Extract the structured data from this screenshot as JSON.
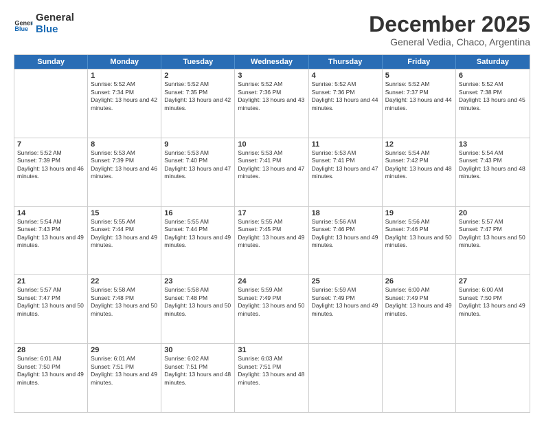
{
  "logo": {
    "general": "General",
    "blue": "Blue"
  },
  "header": {
    "month": "December 2025",
    "location": "General Vedia, Chaco, Argentina"
  },
  "weekdays": [
    "Sunday",
    "Monday",
    "Tuesday",
    "Wednesday",
    "Thursday",
    "Friday",
    "Saturday"
  ],
  "weeks": [
    [
      {
        "day": "",
        "sunrise": "",
        "sunset": "",
        "daylight": ""
      },
      {
        "day": "1",
        "sunrise": "Sunrise: 5:52 AM",
        "sunset": "Sunset: 7:34 PM",
        "daylight": "Daylight: 13 hours and 42 minutes."
      },
      {
        "day": "2",
        "sunrise": "Sunrise: 5:52 AM",
        "sunset": "Sunset: 7:35 PM",
        "daylight": "Daylight: 13 hours and 42 minutes."
      },
      {
        "day": "3",
        "sunrise": "Sunrise: 5:52 AM",
        "sunset": "Sunset: 7:36 PM",
        "daylight": "Daylight: 13 hours and 43 minutes."
      },
      {
        "day": "4",
        "sunrise": "Sunrise: 5:52 AM",
        "sunset": "Sunset: 7:36 PM",
        "daylight": "Daylight: 13 hours and 44 minutes."
      },
      {
        "day": "5",
        "sunrise": "Sunrise: 5:52 AM",
        "sunset": "Sunset: 7:37 PM",
        "daylight": "Daylight: 13 hours and 44 minutes."
      },
      {
        "day": "6",
        "sunrise": "Sunrise: 5:52 AM",
        "sunset": "Sunset: 7:38 PM",
        "daylight": "Daylight: 13 hours and 45 minutes."
      }
    ],
    [
      {
        "day": "7",
        "sunrise": "Sunrise: 5:52 AM",
        "sunset": "Sunset: 7:39 PM",
        "daylight": "Daylight: 13 hours and 46 minutes."
      },
      {
        "day": "8",
        "sunrise": "Sunrise: 5:53 AM",
        "sunset": "Sunset: 7:39 PM",
        "daylight": "Daylight: 13 hours and 46 minutes."
      },
      {
        "day": "9",
        "sunrise": "Sunrise: 5:53 AM",
        "sunset": "Sunset: 7:40 PM",
        "daylight": "Daylight: 13 hours and 47 minutes."
      },
      {
        "day": "10",
        "sunrise": "Sunrise: 5:53 AM",
        "sunset": "Sunset: 7:41 PM",
        "daylight": "Daylight: 13 hours and 47 minutes."
      },
      {
        "day": "11",
        "sunrise": "Sunrise: 5:53 AM",
        "sunset": "Sunset: 7:41 PM",
        "daylight": "Daylight: 13 hours and 47 minutes."
      },
      {
        "day": "12",
        "sunrise": "Sunrise: 5:54 AM",
        "sunset": "Sunset: 7:42 PM",
        "daylight": "Daylight: 13 hours and 48 minutes."
      },
      {
        "day": "13",
        "sunrise": "Sunrise: 5:54 AM",
        "sunset": "Sunset: 7:43 PM",
        "daylight": "Daylight: 13 hours and 48 minutes."
      }
    ],
    [
      {
        "day": "14",
        "sunrise": "Sunrise: 5:54 AM",
        "sunset": "Sunset: 7:43 PM",
        "daylight": "Daylight: 13 hours and 49 minutes."
      },
      {
        "day": "15",
        "sunrise": "Sunrise: 5:55 AM",
        "sunset": "Sunset: 7:44 PM",
        "daylight": "Daylight: 13 hours and 49 minutes."
      },
      {
        "day": "16",
        "sunrise": "Sunrise: 5:55 AM",
        "sunset": "Sunset: 7:44 PM",
        "daylight": "Daylight: 13 hours and 49 minutes."
      },
      {
        "day": "17",
        "sunrise": "Sunrise: 5:55 AM",
        "sunset": "Sunset: 7:45 PM",
        "daylight": "Daylight: 13 hours and 49 minutes."
      },
      {
        "day": "18",
        "sunrise": "Sunrise: 5:56 AM",
        "sunset": "Sunset: 7:46 PM",
        "daylight": "Daylight: 13 hours and 49 minutes."
      },
      {
        "day": "19",
        "sunrise": "Sunrise: 5:56 AM",
        "sunset": "Sunset: 7:46 PM",
        "daylight": "Daylight: 13 hours and 50 minutes."
      },
      {
        "day": "20",
        "sunrise": "Sunrise: 5:57 AM",
        "sunset": "Sunset: 7:47 PM",
        "daylight": "Daylight: 13 hours and 50 minutes."
      }
    ],
    [
      {
        "day": "21",
        "sunrise": "Sunrise: 5:57 AM",
        "sunset": "Sunset: 7:47 PM",
        "daylight": "Daylight: 13 hours and 50 minutes."
      },
      {
        "day": "22",
        "sunrise": "Sunrise: 5:58 AM",
        "sunset": "Sunset: 7:48 PM",
        "daylight": "Daylight: 13 hours and 50 minutes."
      },
      {
        "day": "23",
        "sunrise": "Sunrise: 5:58 AM",
        "sunset": "Sunset: 7:48 PM",
        "daylight": "Daylight: 13 hours and 50 minutes."
      },
      {
        "day": "24",
        "sunrise": "Sunrise: 5:59 AM",
        "sunset": "Sunset: 7:49 PM",
        "daylight": "Daylight: 13 hours and 50 minutes."
      },
      {
        "day": "25",
        "sunrise": "Sunrise: 5:59 AM",
        "sunset": "Sunset: 7:49 PM",
        "daylight": "Daylight: 13 hours and 49 minutes."
      },
      {
        "day": "26",
        "sunrise": "Sunrise: 6:00 AM",
        "sunset": "Sunset: 7:49 PM",
        "daylight": "Daylight: 13 hours and 49 minutes."
      },
      {
        "day": "27",
        "sunrise": "Sunrise: 6:00 AM",
        "sunset": "Sunset: 7:50 PM",
        "daylight": "Daylight: 13 hours and 49 minutes."
      }
    ],
    [
      {
        "day": "28",
        "sunrise": "Sunrise: 6:01 AM",
        "sunset": "Sunset: 7:50 PM",
        "daylight": "Daylight: 13 hours and 49 minutes."
      },
      {
        "day": "29",
        "sunrise": "Sunrise: 6:01 AM",
        "sunset": "Sunset: 7:51 PM",
        "daylight": "Daylight: 13 hours and 49 minutes."
      },
      {
        "day": "30",
        "sunrise": "Sunrise: 6:02 AM",
        "sunset": "Sunset: 7:51 PM",
        "daylight": "Daylight: 13 hours and 48 minutes."
      },
      {
        "day": "31",
        "sunrise": "Sunrise: 6:03 AM",
        "sunset": "Sunset: 7:51 PM",
        "daylight": "Daylight: 13 hours and 48 minutes."
      },
      {
        "day": "",
        "sunrise": "",
        "sunset": "",
        "daylight": ""
      },
      {
        "day": "",
        "sunrise": "",
        "sunset": "",
        "daylight": ""
      },
      {
        "day": "",
        "sunrise": "",
        "sunset": "",
        "daylight": ""
      }
    ]
  ]
}
